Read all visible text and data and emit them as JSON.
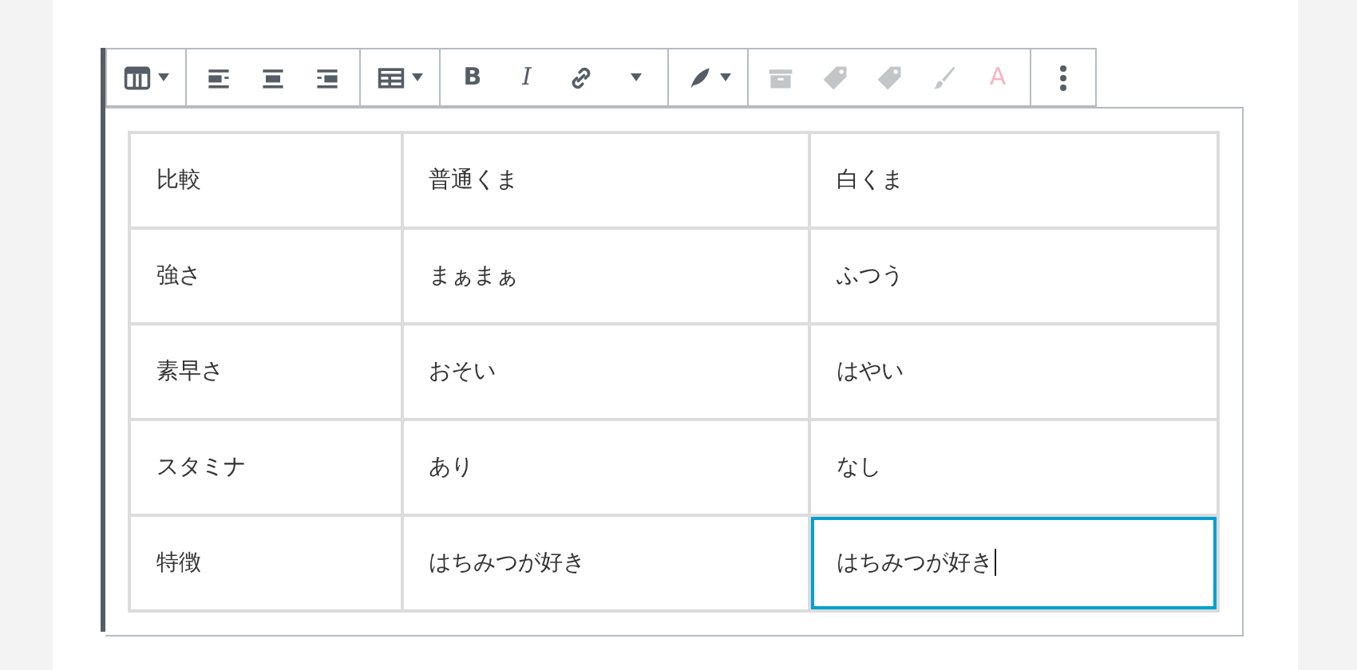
{
  "toolbar": {
    "groups": [
      {
        "buttons": [
          {
            "kind": "table",
            "caret": true,
            "disabled": false
          }
        ]
      },
      {
        "buttons": [
          {
            "kind": "align-left",
            "caret": false,
            "disabled": false
          },
          {
            "kind": "align-center",
            "caret": false,
            "disabled": false
          },
          {
            "kind": "align-right",
            "caret": false,
            "disabled": false
          }
        ]
      },
      {
        "buttons": [
          {
            "kind": "table-edit",
            "caret": true,
            "disabled": false
          }
        ]
      },
      {
        "buttons": [
          {
            "kind": "bold",
            "label": "B",
            "caret": false,
            "disabled": false
          },
          {
            "kind": "italic",
            "label": "I",
            "caret": false,
            "disabled": false
          },
          {
            "kind": "link",
            "caret": false,
            "disabled": false
          },
          {
            "kind": "more-format",
            "caret": true,
            "disabled": false
          }
        ]
      },
      {
        "buttons": [
          {
            "kind": "feather",
            "caret": true,
            "disabled": false
          }
        ]
      },
      {
        "buttons": [
          {
            "kind": "archive",
            "caret": false,
            "disabled": true
          },
          {
            "kind": "tag",
            "caret": false,
            "disabled": true
          },
          {
            "kind": "tag",
            "caret": false,
            "disabled": true
          },
          {
            "kind": "brush",
            "caret": false,
            "disabled": true
          },
          {
            "kind": "text-color",
            "label": "A",
            "caret": false,
            "disabled": true
          }
        ]
      },
      {
        "buttons": [
          {
            "kind": "more",
            "caret": false,
            "disabled": false
          }
        ]
      }
    ]
  },
  "table": {
    "rows": [
      {
        "cells": [
          {
            "text": "比較",
            "selected": false
          },
          {
            "text": "普通くま",
            "selected": false
          },
          {
            "text": "白くま",
            "selected": false
          }
        ]
      },
      {
        "cells": [
          {
            "text": "強さ",
            "selected": false
          },
          {
            "text": "まぁまぁ",
            "selected": false
          },
          {
            "text": "ふつう",
            "selected": false
          }
        ]
      },
      {
        "cells": [
          {
            "text": "素早さ",
            "selected": false
          },
          {
            "text": "おそい",
            "selected": false
          },
          {
            "text": "はやい",
            "selected": false
          }
        ]
      },
      {
        "cells": [
          {
            "text": "スタミナ",
            "selected": false
          },
          {
            "text": "あり",
            "selected": false
          },
          {
            "text": "なし",
            "selected": false
          }
        ]
      },
      {
        "cells": [
          {
            "text": "特徴",
            "selected": false
          },
          {
            "text": "はちみつが好き",
            "selected": false
          },
          {
            "text": "はちみつが好き",
            "selected": true
          }
        ]
      }
    ]
  }
}
